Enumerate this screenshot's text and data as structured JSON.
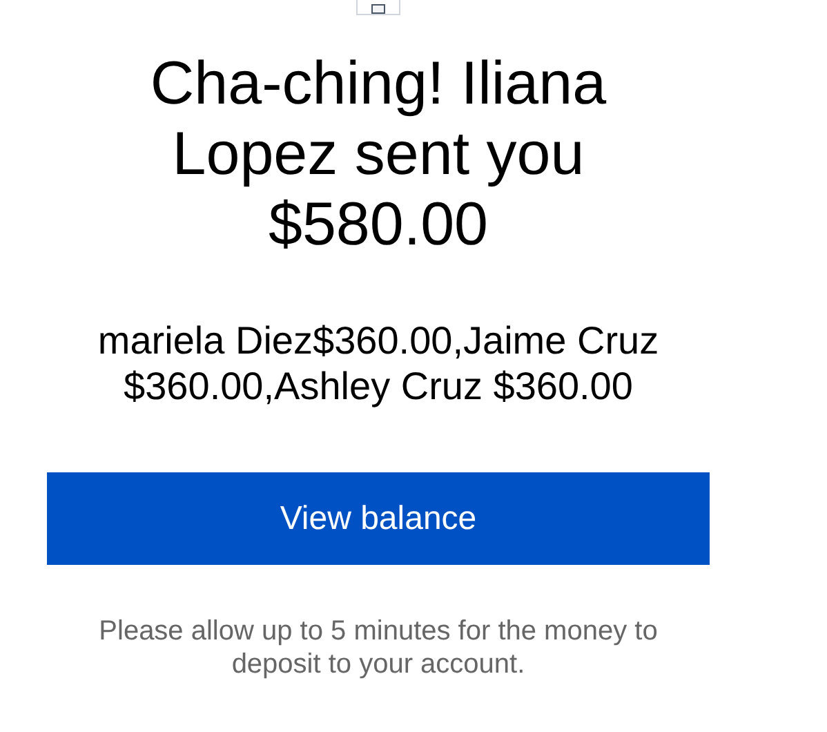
{
  "heading": "Cha-ching! Iliana Lopez sent you $580.00",
  "details": "mariela Diez$360.00,Jaime Cruz $360.00,Ashley Cruz $360.00",
  "button": {
    "label": "View balance"
  },
  "note": "Please allow up to 5 minutes for the money to deposit to your account."
}
